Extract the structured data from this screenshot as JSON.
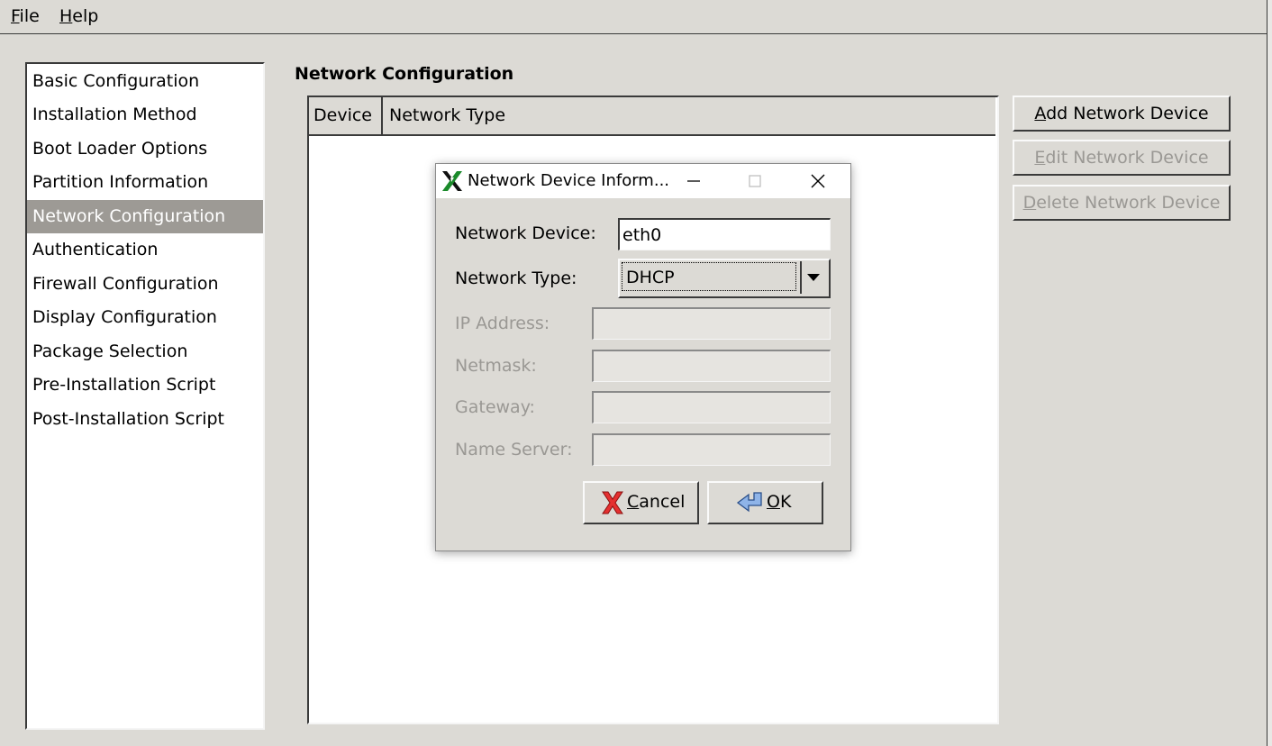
{
  "menubar": {
    "file": {
      "mnemonic": "F",
      "rest": "ile"
    },
    "help": {
      "mnemonic": "H",
      "rest": "elp"
    }
  },
  "sidebar": {
    "items": [
      {
        "label": "Basic Configuration",
        "selected": false
      },
      {
        "label": "Installation Method",
        "selected": false
      },
      {
        "label": "Boot Loader Options",
        "selected": false
      },
      {
        "label": "Partition Information",
        "selected": false
      },
      {
        "label": "Network Configuration",
        "selected": true
      },
      {
        "label": "Authentication",
        "selected": false
      },
      {
        "label": "Firewall Configuration",
        "selected": false
      },
      {
        "label": "Display Configuration",
        "selected": false
      },
      {
        "label": "Package Selection",
        "selected": false
      },
      {
        "label": "Pre-Installation Script",
        "selected": false
      },
      {
        "label": "Post-Installation Script",
        "selected": false
      }
    ],
    "selected_bg": "#9d9a95"
  },
  "main": {
    "title": "Network Configuration",
    "table": {
      "columns": [
        "Device",
        "Network Type"
      ],
      "rows": []
    },
    "buttons": {
      "add": {
        "mnemonic": "A",
        "rest": "dd Network Device",
        "enabled": true
      },
      "edit": {
        "mnemonic": "E",
        "rest": "dit Network Device",
        "enabled": false
      },
      "delete": {
        "mnemonic": "D",
        "rest": "elete Network Device",
        "enabled": false
      }
    }
  },
  "dialog": {
    "title": "Network Device Inform...",
    "icons": {
      "app": "x-logo-icon",
      "minimize": "minimize-icon",
      "maximize": "maximize-icon",
      "close": "close-icon"
    },
    "fields": {
      "device": {
        "label": "Network Device:",
        "value": "eth0"
      },
      "type": {
        "label": "Network Type:",
        "value": "DHCP"
      },
      "ip": {
        "label": "IP Address:",
        "value": ""
      },
      "netmask": {
        "label": "Netmask:",
        "value": ""
      },
      "gateway": {
        "label": "Gateway:",
        "value": ""
      },
      "nameserver": {
        "label": "Name Server:",
        "value": ""
      }
    },
    "buttons": {
      "cancel": {
        "mnemonic": "C",
        "rest": "ancel",
        "icon": "red-x-icon"
      },
      "ok": {
        "mnemonic": "O",
        "rest": "K",
        "icon": "enter-arrow-icon"
      }
    }
  },
  "colors": {
    "window_bg": "#dcdad5",
    "disabled_text": "#9a9894",
    "selection": "#9d9a95"
  }
}
